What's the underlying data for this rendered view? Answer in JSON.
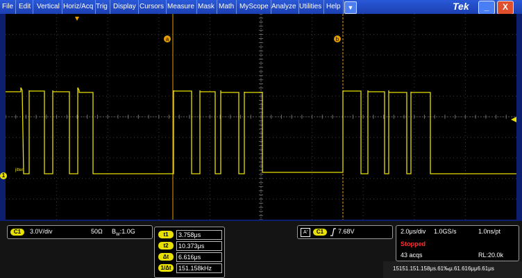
{
  "menu": {
    "items": [
      "File",
      "Edit",
      "Vertical",
      "Horiz/Acq",
      "Trig",
      "Display",
      "Cursors",
      "Measure",
      "Mask",
      "Math",
      "MyScope",
      "Analyze",
      "Utilities",
      "Help"
    ],
    "dropdown_icon": "chevron-down-icon",
    "brand": "Tek",
    "minimize_label": "_",
    "close_label": "X"
  },
  "screen": {
    "cursor_a_label": "a",
    "cursor_b_label": "b",
    "channel_marker": "1",
    "ref_label": "jitter",
    "trace_color": "#e8e000",
    "cursor_color": "#e8a000"
  },
  "channel": {
    "badge": "C1",
    "scale": "3.0V/div",
    "impedance": "50Ω",
    "bandwidth_prefix": "B",
    "bandwidth_sub": "W",
    "bandwidth_value": ":1.0G"
  },
  "cursors": {
    "t1_label": "t1",
    "t1_value": "3.758μs",
    "t2_label": "t2",
    "t2_value": "10.373μs",
    "dt_label": "Δt",
    "dt_value": "6.616μs",
    "inv_label": "1/Δt",
    "inv_value": "151.158kHz"
  },
  "trigger": {
    "mode": "A'",
    "source": "C1",
    "slope_icon": "rising-edge-icon",
    "level": "7.68V"
  },
  "acquisition": {
    "time_div": "2.0μs/div",
    "sample_rate": "1.0GS/s",
    "resolution": "1.0ns/pt",
    "status": "Stopped",
    "acqs": "43 acqs",
    "record_length": "RL:20.0k"
  },
  "readout_overlay": "15151.151.158μs.61‰μ.61.616μμ6.61μs"
}
